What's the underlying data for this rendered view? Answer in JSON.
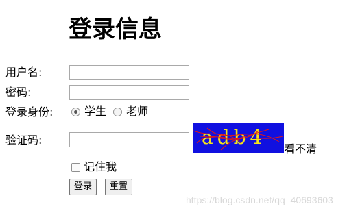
{
  "form": {
    "title": "登录信息",
    "username_label": "用户名:",
    "username_value": "",
    "password_label": "密码:",
    "password_value": "",
    "role_label": "登录身份:",
    "roles": [
      {
        "label": "学生",
        "checked": true
      },
      {
        "label": "老师",
        "checked": false
      }
    ],
    "captcha_label": "验证码:",
    "captcha_value": "",
    "captcha_text": "adb4",
    "captcha_refresh": "看不清",
    "remember_label": "记住我",
    "remember_checked": false,
    "login_button": "登录",
    "reset_button": "重置"
  },
  "watermark": "https://blog.csdn.net/qq_40693603",
  "colors": {
    "captcha_bg": "#1010e0",
    "captcha_text": "#f5e61a",
    "captcha_noise": "#e01818"
  }
}
